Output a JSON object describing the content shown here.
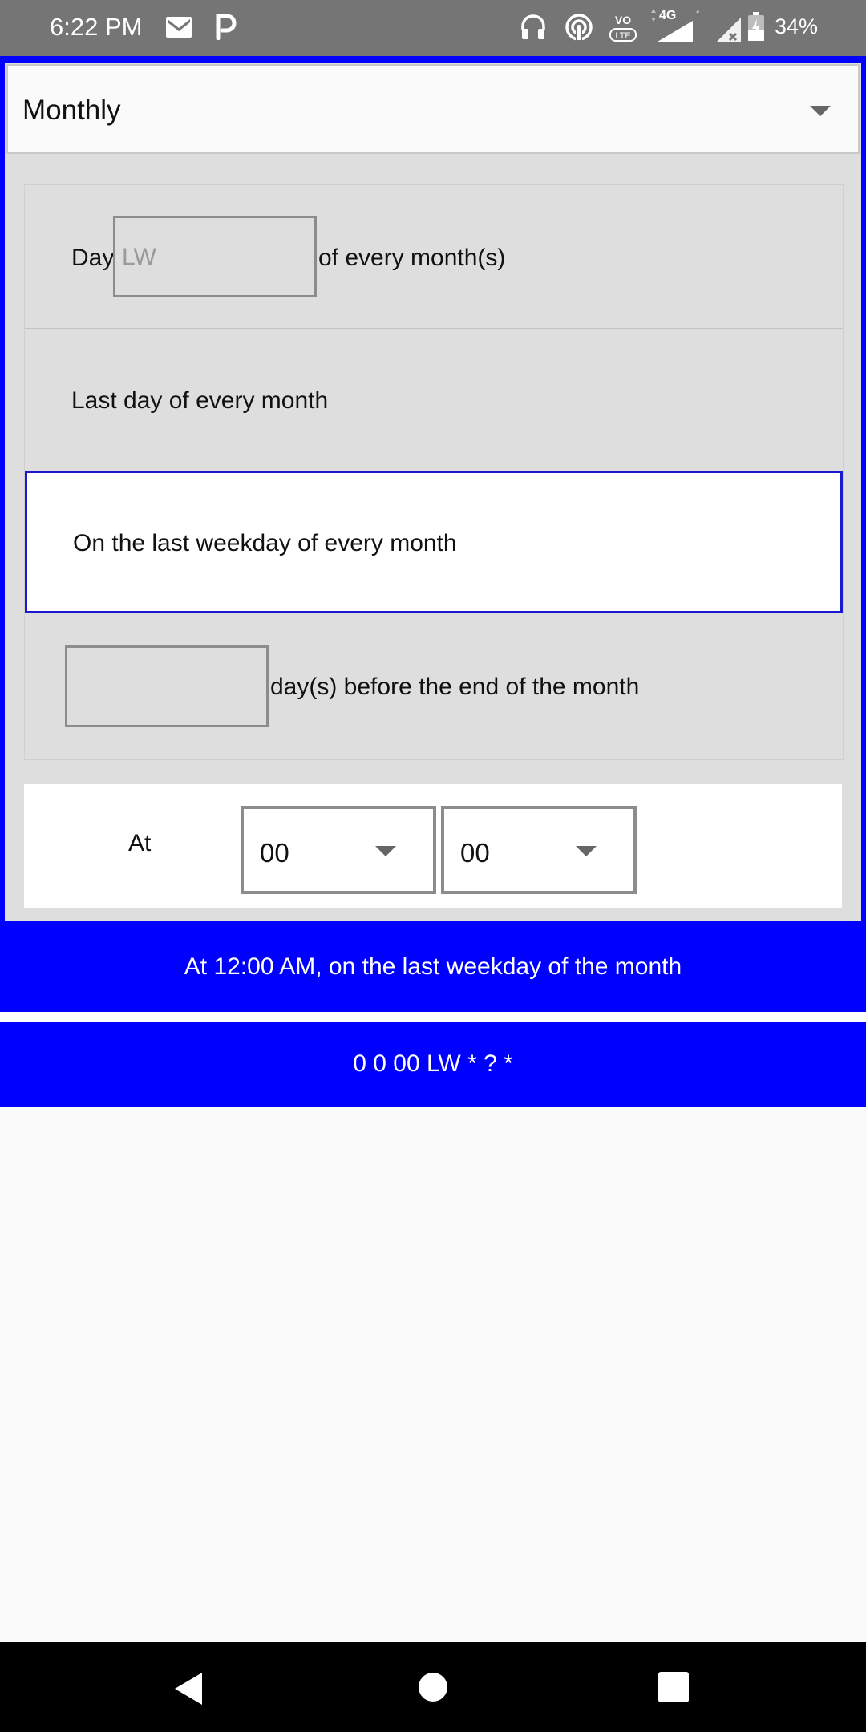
{
  "status_bar": {
    "time": "6:22 PM",
    "battery": "34%",
    "network": "4G",
    "icons": [
      "gmail-icon",
      "p-app-icon",
      "headset-icon",
      "hotspot-icon",
      "volte-icon",
      "signal-icon",
      "battery-icon"
    ]
  },
  "frequency": {
    "selected": "Monthly"
  },
  "options": {
    "day_prefix": "Day",
    "day_placeholder": "LW",
    "day_suffix": "of every month(s)",
    "last_day": "Last day of every month",
    "last_weekday": "On the last weekday of every month",
    "days_before_end_suffix": "day(s) before the end of the month"
  },
  "time": {
    "label": "At",
    "hour": "00",
    "minute": "00"
  },
  "description": "At 12:00 AM, on the last weekday of the month",
  "cron_expression": "0 0 00 LW * ? *",
  "colors": {
    "accent": "#0000ff",
    "status_bar": "#757575",
    "selected_border": "#1a1acc"
  }
}
